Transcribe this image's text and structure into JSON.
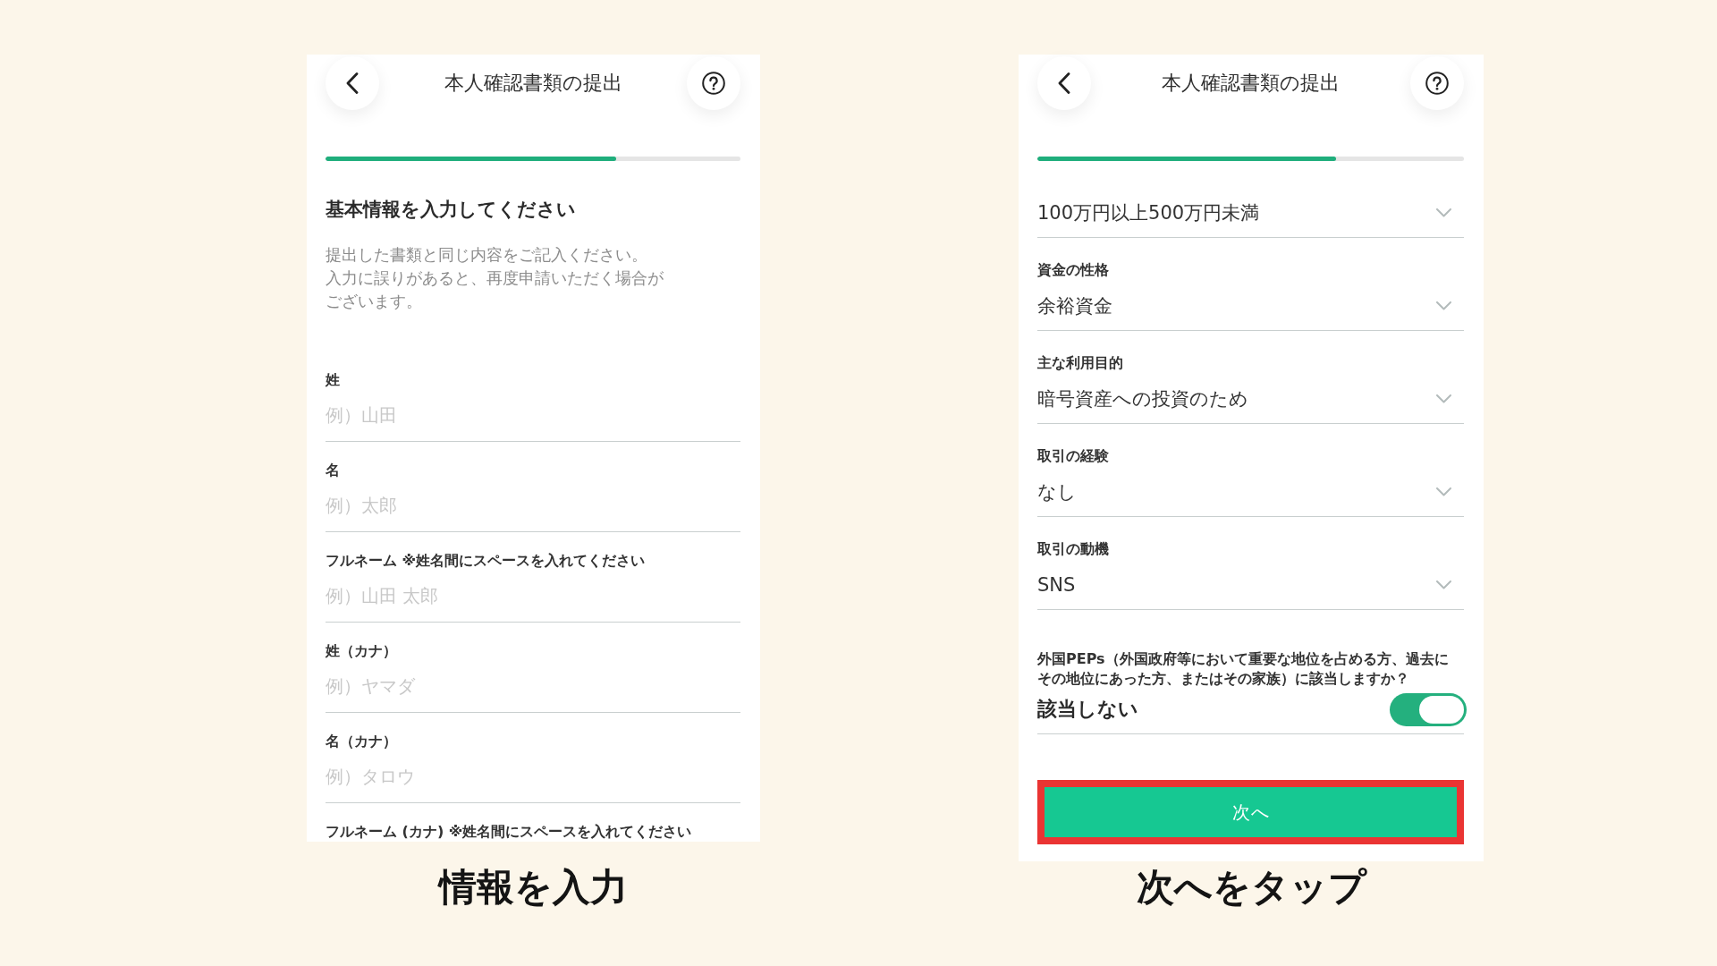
{
  "screens": [
    {
      "title": "本人確認書類の提出",
      "progress": {
        "level": 0.7
      },
      "heading": "基本情報を入力してください",
      "description": [
        "提出した書類と同じ内容をご記入ください。",
        "入力に誤りがあると、再度申請いただく場合が",
        "ございます。"
      ],
      "fields": [
        {
          "kind": "input",
          "label": "姓",
          "placeholder": "例）山田"
        },
        {
          "kind": "input",
          "label": "名",
          "placeholder": "例）太郎"
        },
        {
          "kind": "input",
          "label": "フルネーム ※姓名間にスペースを入れてください",
          "placeholder": "例）山田 太郎"
        },
        {
          "kind": "input",
          "label": "姓（カナ）",
          "placeholder": "例）ヤマダ"
        },
        {
          "kind": "input",
          "label": "名（カナ）",
          "placeholder": "例）タロウ"
        },
        {
          "kind": "input",
          "label": "フルネーム (カナ) ※姓名間にスペースを入れてください"
        }
      ],
      "caption": "情報を入力"
    },
    {
      "title": "本人確認書類の提出",
      "progress": {
        "level": 0.7
      },
      "fields": [
        {
          "kind": "select",
          "value": "100万円以上500万円未満"
        },
        {
          "kind": "select",
          "label": "資金の性格",
          "value": "余裕資金"
        },
        {
          "kind": "select",
          "label": "主な利用目的",
          "value": "暗号資産への投資のため"
        },
        {
          "kind": "select",
          "label": "取引の経験",
          "value": "なし"
        },
        {
          "kind": "select",
          "label": "取引の動機",
          "value": "SNS"
        }
      ],
      "question": [
        "外国PEPs（外国政府等において重要な地位を占める方、過去に",
        "その地位にあった方、またはその家族）に該当しますか？"
      ],
      "toggle": {
        "label": "該当しない",
        "on": true
      },
      "button": {
        "label": "次へ",
        "highlighted": true
      },
      "caption": "次へをタップ"
    }
  ]
}
